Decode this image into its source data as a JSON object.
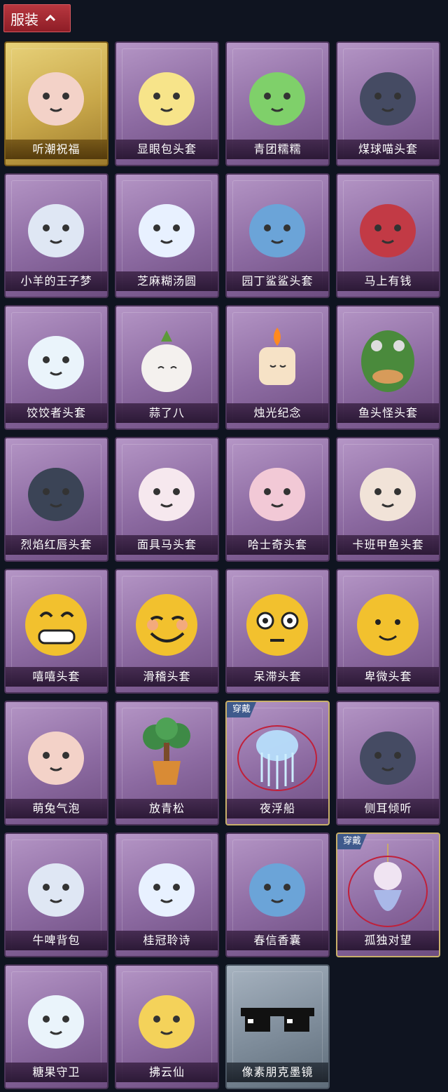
{
  "section": {
    "title": "服装"
  },
  "colors": {
    "card_purple": "#9a78ae",
    "card_gold": "#d4b558",
    "card_gray": "#8c98a6",
    "tab_red": "#a52a33"
  },
  "items": [
    {
      "name": "听潮祝福",
      "style": "gold",
      "icon": "winged-figure-icon"
    },
    {
      "name": "显眼包头套",
      "style": "purple",
      "icon": "lightbulb-head-icon"
    },
    {
      "name": "青团糯糯",
      "style": "purple",
      "icon": "green-dumpling-icon"
    },
    {
      "name": "煤球喵头套",
      "style": "purple",
      "icon": "black-cat-head-icon"
    },
    {
      "name": "小羊的王子梦",
      "style": "purple",
      "icon": "crowned-sheep-icon"
    },
    {
      "name": "芝麻糊汤圆",
      "style": "purple",
      "icon": "white-dumpling-icon"
    },
    {
      "name": "园丁鲨鲨头套",
      "style": "purple",
      "icon": "shark-head-icon"
    },
    {
      "name": "马上有钱",
      "style": "purple",
      "icon": "red-horse-head-icon"
    },
    {
      "name": "饺饺者头套",
      "style": "purple",
      "icon": "cloud-dumpling-icon"
    },
    {
      "name": "蒜了八",
      "style": "purple",
      "icon": "garlic-icon"
    },
    {
      "name": "烛光纪念",
      "style": "purple",
      "icon": "candle-icon"
    },
    {
      "name": "鱼头怪头套",
      "style": "purple",
      "icon": "fish-head-icon"
    },
    {
      "name": "烈焰红唇头套",
      "style": "purple",
      "icon": "yellow-mask-sunglasses-icon"
    },
    {
      "name": "面具马头套",
      "style": "purple",
      "icon": "horse-mask-icon"
    },
    {
      "name": "哈士奇头套",
      "style": "purple",
      "icon": "dog-sunglasses-icon"
    },
    {
      "name": "卡班甲鱼头套",
      "style": "purple",
      "icon": "whale-head-icon"
    },
    {
      "name": "嘻嘻头套",
      "style": "purple",
      "icon": "grin-emoji-icon"
    },
    {
      "name": "滑稽头套",
      "style": "purple",
      "icon": "smirk-emoji-icon"
    },
    {
      "name": "呆滞头套",
      "style": "purple",
      "icon": "stare-emoji-icon"
    },
    {
      "name": "卑微头套",
      "style": "purple",
      "icon": "shy-emoji-icon"
    },
    {
      "name": "萌兔气泡",
      "style": "purple",
      "icon": "bubble-figure-icon"
    },
    {
      "name": "放青松",
      "style": "purple",
      "icon": "potted-pine-icon"
    },
    {
      "name": "夜浮船",
      "style": "purple",
      "icon": "jellyfish-icon",
      "worn": true,
      "worn_label": "穿戴"
    },
    {
      "name": "侧耳倾听",
      "style": "purple",
      "icon": "lotus-wreath-icon"
    },
    {
      "name": "牛啤背包",
      "style": "purple",
      "icon": "cow-barrel-icon"
    },
    {
      "name": "桂冠聆诗",
      "style": "purple",
      "icon": "fairy-charm-icon"
    },
    {
      "name": "春信香囊",
      "style": "purple",
      "icon": "sachet-icon"
    },
    {
      "name": "孤独对望",
      "style": "purple",
      "icon": "doll-charm-icon",
      "worn": true,
      "worn_label": "穿戴"
    },
    {
      "name": "糖果守卫",
      "style": "purple",
      "icon": "pumpkin-charm-icon"
    },
    {
      "name": "拂云仙",
      "style": "purple",
      "icon": "cloud-fairy-charm-icon"
    },
    {
      "name": "像素朋克墨镜",
      "style": "gray",
      "icon": "pixel-sunglasses-icon"
    }
  ]
}
